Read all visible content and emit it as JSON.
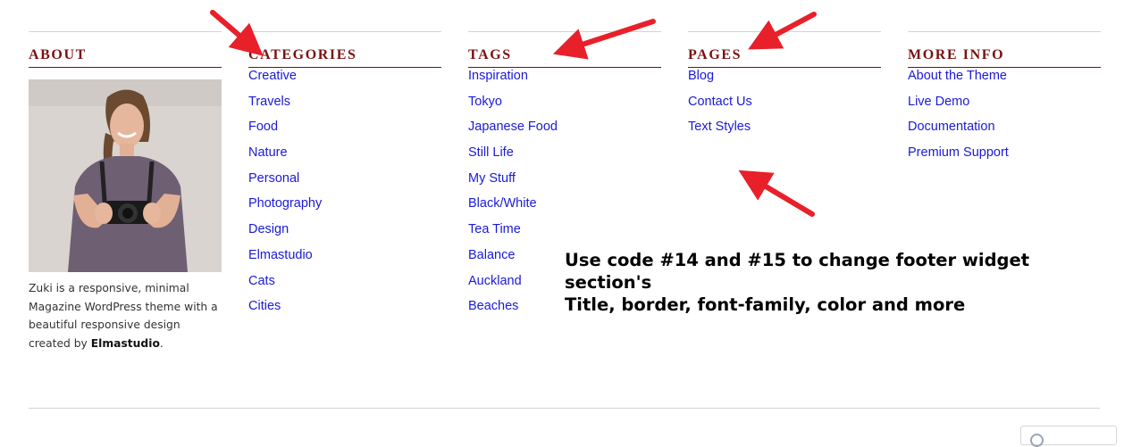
{
  "about": {
    "title": "ABOUT",
    "image_alt": "woman holding camera",
    "text_prefix": "Zuki is a responsive, minimal Magazine WordPress theme with a beautiful responsive design created by ",
    "text_link": "Elmastudio",
    "text_suffix": "."
  },
  "categories": {
    "title": "CATEGORIES",
    "items": [
      "Creative",
      "Travels",
      "Food",
      "Nature",
      "Personal",
      "Photography",
      "Design",
      "Elmastudio",
      "Cats",
      "Cities"
    ]
  },
  "tags": {
    "title": "TAGS",
    "items": [
      "Inspiration",
      "Tokyo",
      "Japanese Food",
      "Still Life",
      "My Stuff",
      "Black/White",
      "Tea Time",
      "Balance",
      "Auckland",
      "Beaches"
    ]
  },
  "pages": {
    "title": "PAGES",
    "items": [
      "Blog",
      "Contact Us",
      "Text Styles"
    ]
  },
  "more_info": {
    "title": "MORE INFO",
    "items": [
      "About the Theme",
      "Live Demo",
      "Documentation",
      "Premium Support"
    ]
  },
  "annotation": {
    "line1": "Use code #14 and #15  to change footer widget section's",
    "line2": "Title, border, font-family, color and more"
  },
  "colors": {
    "widget_title": "#7a1010",
    "link": "#1a1ad6",
    "arrow": "#e8202a"
  },
  "icons": [
    "arrow-annotation-icon",
    "search-icon"
  ]
}
